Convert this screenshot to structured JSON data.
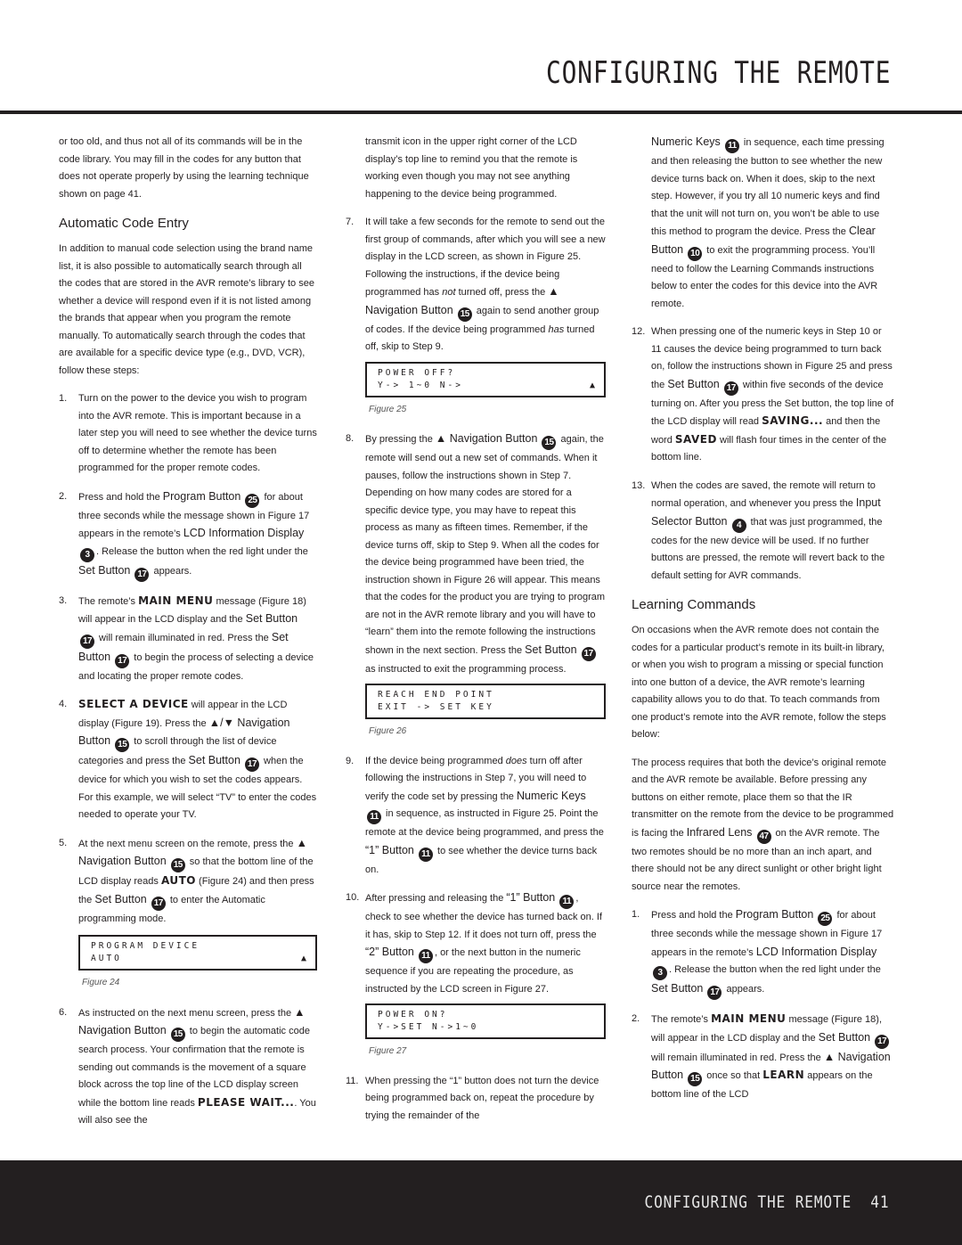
{
  "header": {
    "title": "CONFIGURING THE REMOTE"
  },
  "footer": {
    "section": "CONFIGURING THE REMOTE",
    "page_number": "41"
  },
  "col1": {
    "intro": "or too old, and thus not all of its commands will be in the code library. You may fill in the codes for any button that does not operate properly by using the learning technique shown on page 41.",
    "heading": "Automatic Code Entry",
    "para": "In addition to manual code selection using the brand name list, it is also possible to automatically search through all the codes that are stored in the AVR remote’s library to see whether a device will respond even if it is not listed among the brands that appear when you program the remote manually. To automatically search through the codes that are available for a specific device type (e.g., DVD, VCR), follow these steps:",
    "s1": {
      "num": "1.",
      "text": "Turn on the power to the device you wish to program into the AVR remote. This is important because in a later step you will need to see whether the device turns off to determine whether the remote has been programmed for the proper remote codes."
    },
    "s2": {
      "num": "2.",
      "a": "Press and hold the ",
      "b": "Program Button",
      "c": " for about three seconds while the message shown in Figure 17 appears in the remote’s ",
      "d": "LCD Information Display",
      "e": ". Release the button when the red light under the ",
      "f": "Set Button",
      "g": " appears.",
      "badge1": "25",
      "badge2": "3",
      "badge3": "17"
    },
    "s3": {
      "num": "3.",
      "a": "The remote’s ",
      "lcd": "MAIN MENU",
      "b": " message (Figure 18) will appear in the LCD display and the ",
      "c": "Set Button",
      "d": " will remain illuminated in red. Press the ",
      "e": "Set Button",
      "f": " to begin the process of selecting a device and locating the proper remote codes.",
      "badge": "17"
    },
    "s4": {
      "num": "4.",
      "lcd": "SELECT A DEVICE",
      "a": " will appear in the LCD display (Figure 19). Press the ",
      "b": "▲/▼ Navigation Button",
      "c": " to scroll through the list of device categories and press the ",
      "d": "Set Button",
      "e": " when the device for which you wish to set the codes appears. For this example, we will select “TV” to enter the codes needed to operate your TV.",
      "badge1": "15",
      "badge2": "17"
    },
    "s5": {
      "num": "5.",
      "a": "At the next menu screen on the remote, press the ",
      "b": "▲ Navigation Button",
      "c": " so that the bottom line of the LCD display reads ",
      "lcd": "AUTO",
      "d": " (Figure 24) and then press the ",
      "e": "Set Button",
      "f": " to enter the Automatic programming mode.",
      "badge1": "15",
      "badge2": "17"
    },
    "fig24": {
      "line1": "PROGRAM DEVICE",
      "line2": "AUTO",
      "arrow": "▲",
      "caption": "Figure 24"
    },
    "s6": {
      "num": "6.",
      "a": "As instructed on the next menu screen, press the ",
      "b": "▲ Navigation Button",
      "c": " to begin the automatic code search process. Your confirmation that the remote is sending out commands is the movement of a square block across the top line of the LCD display screen while the bottom line reads ",
      "lcd": "PLEASE WAIT...",
      "d": ". You will also see the",
      "badge": "15"
    }
  },
  "col2": {
    "cont": "transmit icon in the upper right corner of the LCD display’s top line to remind you that the remote is working even though you may not see anything happening to the device being programmed.",
    "s7": {
      "num": "7.",
      "a": "It will take a few seconds for the remote to send out the first group of commands, after which you will see a new display in the LCD screen, as shown in Figure 25. Following the instructions, if the device being programmed has ",
      "em1": "not",
      "b": " turned off, press the ",
      "c": "▲ Navigation Button",
      "d": " again to send another group of codes. If the device being programmed ",
      "em2": "has",
      "e": " turned off, skip to Step 9.",
      "badge": "15"
    },
    "fig25": {
      "line1": "POWER OFF?",
      "line2": "Y-> 1~0 N->",
      "arrow": "▲",
      "caption": "Figure 25"
    },
    "s8": {
      "num": "8.",
      "a": "By pressing the ",
      "b": "▲ Navigation Button",
      "c": " again, the remote will send out a new set of commands. When it pauses, follow the instructions shown in Step 7. Depending on how many codes are stored for a specific device type, you may have to repeat this process as many as fifteen times. Remember, if the device turns off, skip to Step 9. When all the codes for the device being programmed have been tried, the instruction shown in Figure 26 will appear. This means that the codes for the product you are trying to program are not in the AVR remote library and you will have to “learn” them into the remote following the instructions shown in the next section. Press the ",
      "d": "Set Button",
      "e": " as instructed to exit the programming process.",
      "badge1": "15",
      "badge2": "17"
    },
    "fig26": {
      "line1": "REACH END POINT",
      "line2": "EXIT -> SET KEY",
      "caption": "Figure 26"
    },
    "s9": {
      "num": "9.",
      "a": "If the device being programmed ",
      "em": "does",
      "b": " turn off after following the instructions in Step 7, you will need to verify the code set by pressing the ",
      "c": "Numeric Keys",
      "d": " in sequence, as instructed in Figure 25. Point the remote at the device being programmed, and press the ",
      "e": "“1” Button",
      "f": " to see whether the device turns back on.",
      "badge": "11"
    },
    "s10": {
      "num": "10.",
      "a": "After pressing and releasing the ",
      "b": "“1” Button",
      "c": ", check to see whether the device has turned back on. If it has, skip to Step 12. If it does not turn off, press the ",
      "d": "“2” Button",
      "e": ", or the next button in the numeric sequence if you are repeating the procedure, as instructed by the LCD screen in Figure 27.",
      "badge": "11"
    },
    "fig27": {
      "line1": "POWER ON?",
      "line2": "Y->SET N->1~0",
      "caption": "Figure 27"
    },
    "s11": {
      "num": "11.",
      "a": "When pressing the “1” button does not turn the device being programmed back on, repeat the procedure by trying the remainder of the"
    }
  },
  "col3": {
    "cont": {
      "a": "Numeric Keys",
      "b": " in sequence, each time pressing and then releasing the button to see whether the new device turns back on. When it does, skip to the next step. However, if you try all 10 numeric keys and find that the unit will not turn on, you won’t be able to use this method to program the device. Press the ",
      "c": "Clear Button",
      "d": " to exit the programming process. You’ll need to follow the Learning Commands instructions below to enter the codes for this device into the AVR remote.",
      "badge1": "11",
      "badge2": "10"
    },
    "s12": {
      "num": "12.",
      "a": "When pressing one of the numeric keys in Step 10 or 11 causes the device being programmed to turn back on, follow the instructions shown in Figure 25 and press the ",
      "b": "Set Button",
      "c": " within five seconds of the device turning on. After you press the Set button, the top line of the LCD display will read ",
      "lcd1": "SAVING...",
      "d": " and then the word ",
      "lcd2": "SAVED",
      "e": " will flash four times in the center of the bottom line.",
      "badge": "17"
    },
    "s13": {
      "num": "13.",
      "a": "When the codes are saved, the remote will return to normal operation, and whenever you press the ",
      "b": "Input Selector Button",
      "c": " that was just programmed, the codes for the new device will be used. If no further buttons are pressed, the remote will revert back to the default setting for AVR commands.",
      "badge": "4"
    },
    "heading": "Learning Commands",
    "para1": "On occasions when the AVR remote does not contain the codes for a particular product’s remote in its built-in library, or when you wish to program a missing or special function into one button of a device, the AVR remote’s learning capability allows you to do that. To teach commands from one product’s remote into the AVR remote, follow the steps below:",
    "para2": {
      "a": "The process requires that both the device’s original remote and the AVR remote be available. Before pressing any buttons on either remote, place them so that the IR transmitter on the remote from the device to be programmed is facing the ",
      "b": "Infrared Lens",
      "c": " on the AVR remote. The two remotes should be no more than an inch apart, and there should not be any direct sunlight or other bright light source near the remotes.",
      "badge": "47"
    },
    "l1": {
      "num": "1.",
      "a": "Press and hold the ",
      "b": "Program Button",
      "c": " for about three seconds while the message shown in Figure 17 appears in the remote’s ",
      "d": "LCD Information Display",
      "e": ". Release the button when the red light under the ",
      "f": "Set Button",
      "g": " appears.",
      "badge1": "25",
      "badge2": "3",
      "badge3": "17"
    },
    "l2": {
      "num": "2.",
      "a": "The remote’s ",
      "lcd": "MAIN MENU",
      "b": " message (Figure 18), will appear in the LCD display and the ",
      "c": "Set Button",
      "d": " will remain illuminated in red. Press the ",
      "e": "▲ Navigation Button",
      "f": " once so that ",
      "lcd2": "LEARN",
      "g": " appears on the bottom line of the LCD",
      "badge1": "17",
      "badge2": "15"
    }
  }
}
